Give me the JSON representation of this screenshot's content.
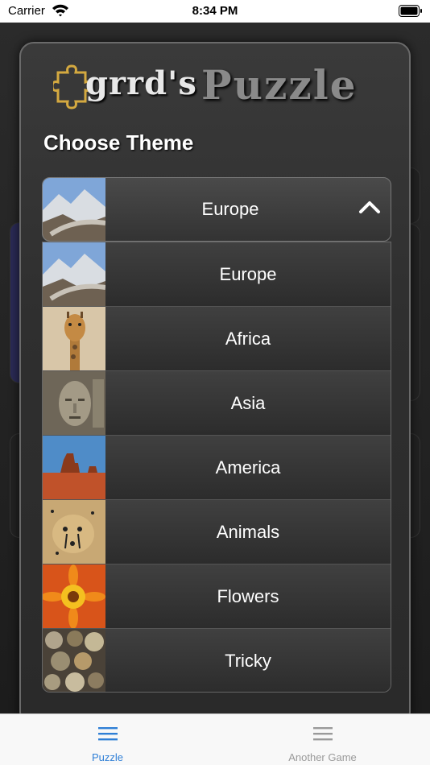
{
  "status_bar": {
    "carrier": "Carrier",
    "time": "8:34 PM"
  },
  "modal": {
    "logo_text_1": "grrd's",
    "logo_text_2": "Puzzle",
    "title": "Choose Theme",
    "selected": "Europe"
  },
  "themes": [
    {
      "label": "Europe"
    },
    {
      "label": "Africa"
    },
    {
      "label": "Asia"
    },
    {
      "label": "America"
    },
    {
      "label": "Animals"
    },
    {
      "label": "Flowers"
    },
    {
      "label": "Tricky"
    }
  ],
  "tab_bar": {
    "tabs": [
      {
        "label": "Puzzle",
        "active": true,
        "color": "#2f7fd6"
      },
      {
        "label": "Another Game",
        "active": false,
        "color": "#9a9a9a"
      }
    ]
  }
}
